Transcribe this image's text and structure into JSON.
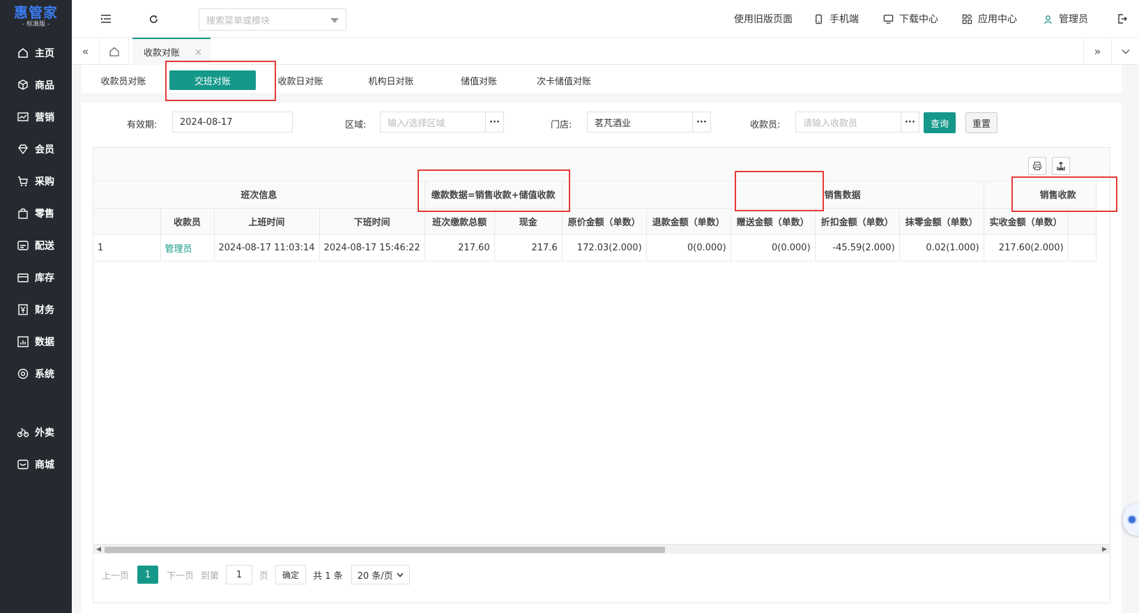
{
  "app": {
    "logo_main": "惠管家",
    "logo_sub": "- 标准版 -"
  },
  "sidebar": {
    "items": [
      {
        "label": "主页",
        "icon": "home-icon"
      },
      {
        "label": "商品",
        "icon": "cube-icon"
      },
      {
        "label": "营销",
        "icon": "chart-icon"
      },
      {
        "label": "会员",
        "icon": "diamond-icon"
      },
      {
        "label": "采购",
        "icon": "cart-icon"
      },
      {
        "label": "零售",
        "icon": "bag-icon"
      },
      {
        "label": "配送",
        "icon": "truck-icon"
      },
      {
        "label": "库存",
        "icon": "box-icon"
      },
      {
        "label": "财务",
        "icon": "yen-icon"
      },
      {
        "label": "数据",
        "icon": "bar-chart-icon"
      },
      {
        "label": "系统",
        "icon": "settings-icon"
      },
      {
        "label": "外卖",
        "icon": "bike-icon"
      },
      {
        "label": "商城",
        "icon": "store-icon"
      }
    ]
  },
  "topbar": {
    "search_placeholder": "搜索菜单或模块",
    "old_page": "使用旧版页面",
    "mobile": "手机端",
    "download": "下载中心",
    "apps": "应用中心",
    "user": "管理员"
  },
  "tabs": {
    "active_label": "收款对账",
    "close_glyph": "×",
    "left_arrow": "«",
    "right_arrow": "»",
    "dropdown_glyph": "⌄"
  },
  "subtabs": [
    "收款员对账",
    "交班对账",
    "收款日对账",
    "机构日对账",
    "储值对账",
    "次卡储值对账"
  ],
  "filters": {
    "date_label": "有效期:",
    "date_value": "2024-08-17",
    "area_label": "区域:",
    "area_placeholder": "输入/选择区域",
    "store_label": "门店:",
    "store_value": "茗芃酒业",
    "cashier_label": "收款员:",
    "cashier_placeholder": "请输入收款员",
    "dots": "···",
    "query": "查询",
    "reset": "重置"
  },
  "grid": {
    "groups": {
      "shift_info": "班次信息",
      "payment": "缴款数据=销售收款+储值收款",
      "sales": "销售数据",
      "sales_receipt": "销售收款"
    },
    "columns": [
      "",
      "收款员",
      "上班时间",
      "下班时间",
      "班次缴款总额",
      "现金",
      "原价金额（单数）",
      "退款金额（单数）",
      "赠送金额（单数）",
      "折扣金额（单数）",
      "抹零金额（单数）",
      "实收金额（单数）"
    ],
    "rows": [
      [
        "1",
        "管理员",
        "2024-08-17 11:03:14",
        "2024-08-17 15:46:22",
        "217.60",
        "217.6",
        "172.03(2.000)",
        "0(0.000)",
        "0(0.000)",
        "-45.59(2.000)",
        "0.02(1.000)",
        "217.60(2.000)"
      ]
    ]
  },
  "pager": {
    "prev": "上一页",
    "page": "1",
    "next": "下一页",
    "goto": "到第",
    "goto_value": "1",
    "page_unit": "页",
    "confirm": "确定",
    "total": "共 1 条",
    "page_size": "20 条/页"
  },
  "colors": {
    "accent": "#15988a",
    "sidebar_bg": "#262a30",
    "highlight": "#e53935"
  }
}
